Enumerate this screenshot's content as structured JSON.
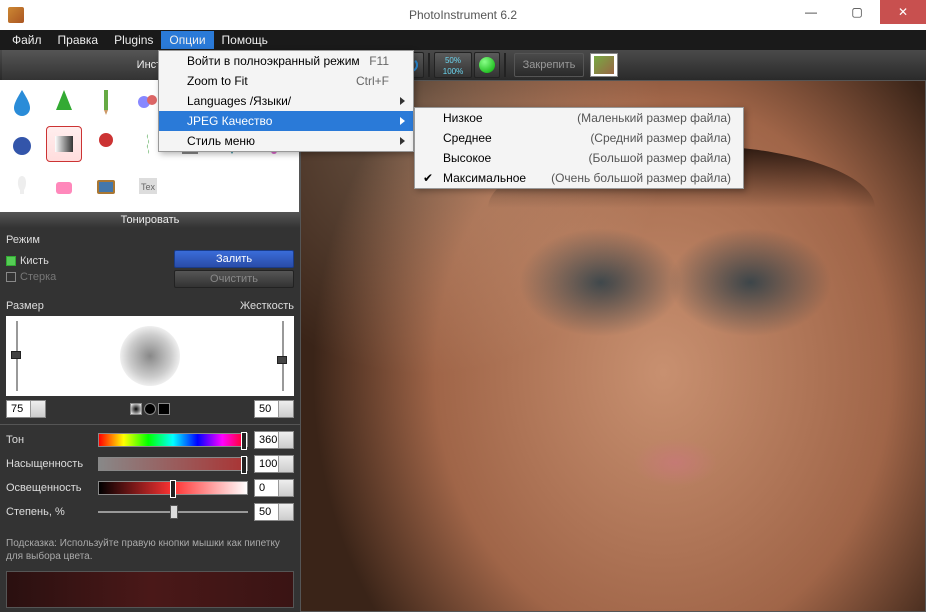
{
  "title": "PhotoInstrument 6.2",
  "menubar": [
    "Файл",
    "Правка",
    "Plugins",
    "Опции",
    "Помощь"
  ],
  "menubar_active_index": 3,
  "tools_header": "Инстр",
  "toolbar": {
    "zoom_top": "50%",
    "zoom_bottom": "100%",
    "pin_label": "Закрепить"
  },
  "dropdown1": [
    {
      "label": "Войти в полноэкранный режим",
      "shortcut": "F11"
    },
    {
      "label": "Zoom to Fit",
      "shortcut": "Ctrl+F"
    },
    {
      "label": "Languages /Языки/",
      "sub": true
    },
    {
      "label": "JPEG Качество",
      "sub": true,
      "highlight": true
    },
    {
      "label": "Стиль меню",
      "sub": true
    }
  ],
  "dropdown2": [
    {
      "label": "Низкое",
      "desc": "(Маленький размер файла)"
    },
    {
      "label": "Среднее",
      "desc": "(Средний размер файла)"
    },
    {
      "label": "Высокое",
      "desc": "(Большой размер файла)"
    },
    {
      "label": "Максимальное",
      "desc": "(Очень большой размер файла)",
      "checked": true
    }
  ],
  "panel_title": "Тонировать",
  "mode": {
    "header": "Режим",
    "brush_label": "Кисть",
    "erase_label": "Стерка",
    "fill_btn": "Залить",
    "clear_btn": "Очистить"
  },
  "brush": {
    "size_label": "Размер",
    "hard_label": "Жесткость",
    "size_value": "75",
    "hard_value": "50"
  },
  "sliders": {
    "hue_label": "Тон",
    "hue_value": "360",
    "sat_label": "Насыщенность",
    "sat_value": "100",
    "lig_label": "Освещенность",
    "lig_value": "0",
    "amt_label": "Степень, %",
    "amt_value": "50"
  },
  "hint": "Подсказка: Используйте правую кнопки мышки как пипетку для выбора цвета."
}
